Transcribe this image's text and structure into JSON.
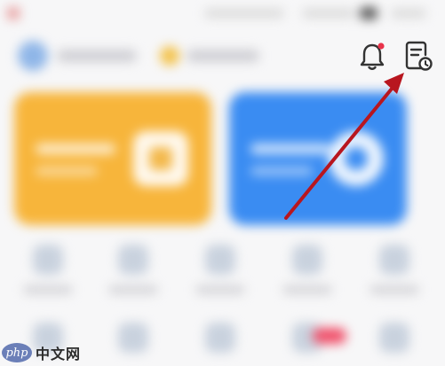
{
  "colors": {
    "background": "#f7f7f8",
    "card_left": "#f7b53b",
    "card_right": "#3a8cf2",
    "bell_dot": "#e8334a",
    "annotation_arrow": "#b8161f",
    "icon_stroke": "#333333"
  },
  "header": {
    "notification_icon": "bell-icon",
    "history_icon": "document-clock-icon",
    "notification_badge_visible": true
  },
  "watermark": {
    "logo_text": "php",
    "text": "中文网"
  }
}
